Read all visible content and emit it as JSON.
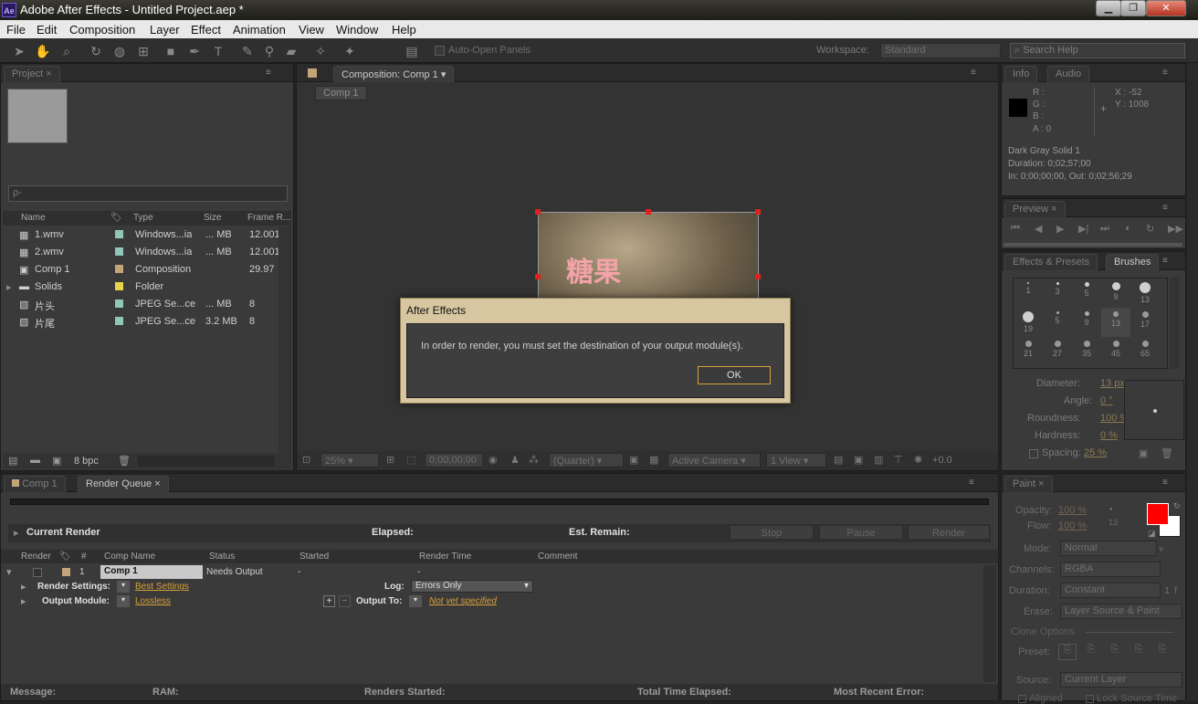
{
  "app": {
    "title": "Adobe After Effects - Untitled Project.aep *",
    "logo": "Ae",
    "window_controls": [
      "minimize-icon",
      "restore-icon",
      "close-icon"
    ]
  },
  "menu": [
    "File",
    "Edit",
    "Composition",
    "Layer",
    "Effect",
    "Animation",
    "View",
    "Window",
    "Help"
  ],
  "toolbar": {
    "auto_open_label": "Auto-Open Panels",
    "workspace_label": "Workspace:",
    "workspace_value": "Standard",
    "search_placeholder": "Search Help"
  },
  "project": {
    "tab": "Project",
    "search_placeholder": "ρ‐",
    "columns": [
      "Name",
      "Type",
      "Size",
      "Frame R..."
    ],
    "rows": [
      {
        "name": "1.wmv",
        "type": "Windows...ia",
        "size": "... MB",
        "rate": "12.001",
        "color": "#8fc7b9"
      },
      {
        "name": "2.wmv",
        "type": "Windows...ia",
        "size": "... MB",
        "rate": "12.001",
        "color": "#8fc7b9"
      },
      {
        "name": "Comp 1",
        "type": "Composition",
        "size": "",
        "rate": "29.97",
        "color": "#c4a57a"
      },
      {
        "name": "Solids",
        "type": "Folder",
        "size": "",
        "rate": "",
        "color": "#e8d44a"
      },
      {
        "name": "片头",
        "type": "JPEG Se...ce",
        "size": "... MB",
        "rate": "8",
        "color": "#8fc7b9"
      },
      {
        "name": "片尾",
        "type": "JPEG Se...ce",
        "size": "3.2 MB",
        "rate": "8",
        "color": "#8fc7b9"
      }
    ],
    "bpc": "8 bpc"
  },
  "composition": {
    "tab": "Composition: Comp 1",
    "subtab": "Comp 1",
    "overlay_text": "糖果",
    "zoom": "25%",
    "timecode": "0;00;00;00",
    "resolution": "(Quarter)",
    "camera": "Active Camera",
    "views": "1 View",
    "exposure": "+0.0"
  },
  "info": {
    "tabs": [
      "Info",
      "Audio"
    ],
    "r": "R :",
    "g": "G :",
    "b": "B :",
    "a": "A : 0",
    "x": "X : -52",
    "y": "Y : 1008",
    "line1": "Dark Gray Solid 1",
    "line2": "Duration: 0;02;57;00",
    "line3": "In: 0;00;00;00, Out: 0;02;56;29"
  },
  "preview": {
    "tab": "Preview"
  },
  "brushes": {
    "tabs": [
      "Effects & Presets",
      "Brushes"
    ],
    "sizes": [
      "1",
      "3",
      "5",
      "9",
      "13",
      "19",
      "5",
      "9",
      "13",
      "17",
      "21",
      "27",
      "35",
      "45",
      "65"
    ],
    "diameter_label": "Diameter:",
    "diameter": "13 px",
    "angle_label": "Angle:",
    "angle": "0 °",
    "roundness_label": "Roundness:",
    "roundness": "100 %",
    "hardness_label": "Hardness:",
    "hardness": "0 %",
    "spacing_label": "Spacing:",
    "spacing": "25 %"
  },
  "render_queue": {
    "tabs": [
      "Comp 1",
      "Render Queue"
    ],
    "current_render": "Current Render",
    "elapsed": "Elapsed:",
    "est_remain": "Est. Remain:",
    "buttons": [
      "Stop",
      "Pause",
      "Render"
    ],
    "columns": [
      "Render",
      "#",
      "Comp Name",
      "Status",
      "Started",
      "Render Time",
      "Comment"
    ],
    "item": {
      "num": "1",
      "comp": "Comp 1",
      "status": "Needs Output",
      "started": "-",
      "render_time": "-"
    },
    "render_settings_label": "Render Settings:",
    "render_settings_value": "Best Settings",
    "log_label": "Log:",
    "log_value": "Errors Only",
    "output_module_label": "Output Module:",
    "output_module_value": "Lossless",
    "output_to_label": "Output To:",
    "output_to_value": "Not yet specified",
    "status_bar": [
      "Message:",
      "RAM:",
      "Renders Started:",
      "Total Time Elapsed:",
      "Most Recent Error:"
    ]
  },
  "paint": {
    "tab": "Paint",
    "opacity_label": "Opacity:",
    "opacity": "100 %",
    "flow_label": "Flow:",
    "flow": "100 %",
    "brush_size": "13",
    "mode_label": "Mode:",
    "mode": "Normal",
    "channels_label": "Channels:",
    "channels": "RGBA",
    "duration_label": "Duration:",
    "duration": "Constant",
    "duration_num": "1",
    "duration_unit": "f",
    "erase_label": "Erase:",
    "erase": "Layer Source & Paint",
    "clone_options": "Clone Options",
    "preset_label": "Preset:",
    "source_label": "Source:",
    "source": "Current Layer",
    "aligned": "Aligned",
    "lock_source_time": "Lock Source Time",
    "fg_color": "#ff0000",
    "bg_color": "#ffffff"
  },
  "dialog": {
    "title": "After Effects",
    "message": "In order to render, you must set the destination of your output module(s).",
    "ok": "OK"
  }
}
